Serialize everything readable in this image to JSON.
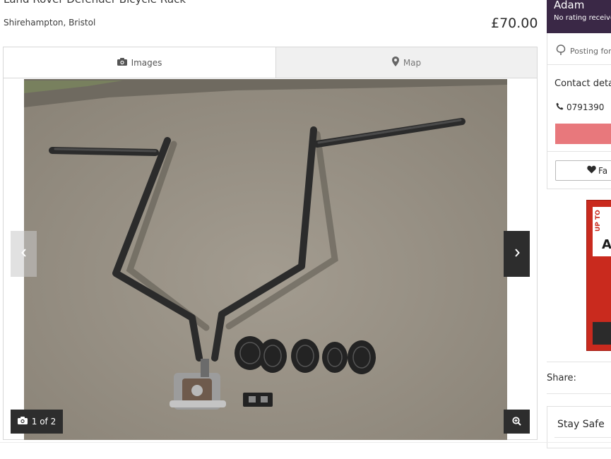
{
  "listing": {
    "title": "Land Rover Defender Bicycle Rack",
    "location": "Shirehampton, Bristol",
    "price": "£70.00"
  },
  "gallery": {
    "tabs": [
      {
        "label": "Images",
        "icon": "camera-icon",
        "active": true
      },
      {
        "label": "Map",
        "icon": "map-pin-icon",
        "active": false
      }
    ],
    "counter": "1 of 2",
    "prev_icon": "chevron-left-icon",
    "next_icon": "chevron-right-icon",
    "zoom_icon": "zoom-in-icon"
  },
  "seller": {
    "name": "Adam",
    "rating": "No rating received"
  },
  "sidebar": {
    "posting_text": "Posting for",
    "contact_title": "Contact details",
    "phone": "0791390",
    "favourite_label": "Fa"
  },
  "ad": {
    "vertical_text": "UP TO",
    "big_text": "A"
  },
  "share_label": "Share:",
  "stay_safe_title": "Stay Safe",
  "colors": {
    "seller_header": "#3a2846",
    "contact_button": "#e8787c",
    "ad_background": "#c92a1e",
    "overlay_button": "#2d2d2d"
  }
}
